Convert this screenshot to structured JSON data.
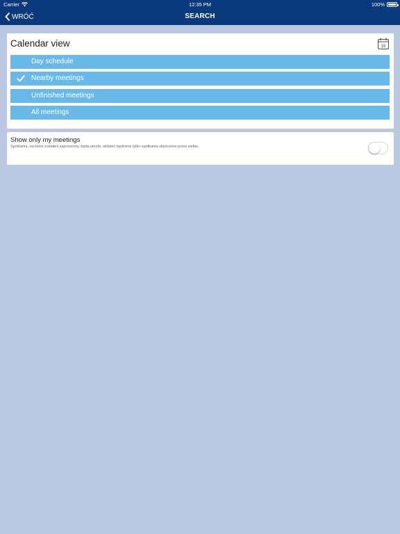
{
  "status_bar": {
    "carrier": "Carrier",
    "time": "12:35 PM",
    "battery": "100%"
  },
  "nav": {
    "back_label": "WRÓĆ",
    "title": "SEARCH"
  },
  "calendar_card": {
    "title": "Calendar view",
    "calendar_icon_day": "15",
    "options": [
      {
        "label": "Day schedule",
        "selected": false
      },
      {
        "label": "Nearby meetings",
        "selected": true
      },
      {
        "label": "Unfinished meetings",
        "selected": false
      },
      {
        "label": "All meetings",
        "selected": false
      }
    ]
  },
  "filter_card": {
    "title": "Show only my meetings",
    "subtitle": "Spotkania, na które zostałeś zaproszony, będą ukryte, widzieć będziesz tylko spotkania utworzone przez siebie.",
    "toggle_on": false
  },
  "colors": {
    "navbar": "#0b3a7c",
    "background": "#bac8e1",
    "option": "#68b9ea"
  }
}
